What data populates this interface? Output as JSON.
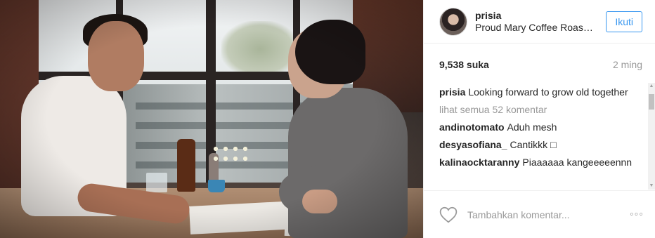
{
  "post": {
    "username": "prisia",
    "location": "Proud Mary Coffee Roasters",
    "follow_label": "Ikuti",
    "likes": "9,538 suka",
    "time_ago": "2 ming"
  },
  "caption": {
    "username": "prisia",
    "text": "Looking forward to grow old together"
  },
  "view_all_comments": "lihat semua 52 komentar",
  "comments": [
    {
      "username": "andinotomato",
      "text": "Aduh mesh"
    },
    {
      "username": "desyasofiana_",
      "text": "Cantikkk □"
    },
    {
      "username": "kalinaocktaranny",
      "text": "Piaaaaaa kangeeeeennn"
    }
  ],
  "add_comment": {
    "placeholder": "Tambahkan komentar..."
  },
  "more_label": "◦◦◦",
  "icons": {
    "like": "heart-outline-icon",
    "more": "more-options-icon"
  },
  "colors": {
    "accent": "#3897f0",
    "muted": "#999999"
  }
}
